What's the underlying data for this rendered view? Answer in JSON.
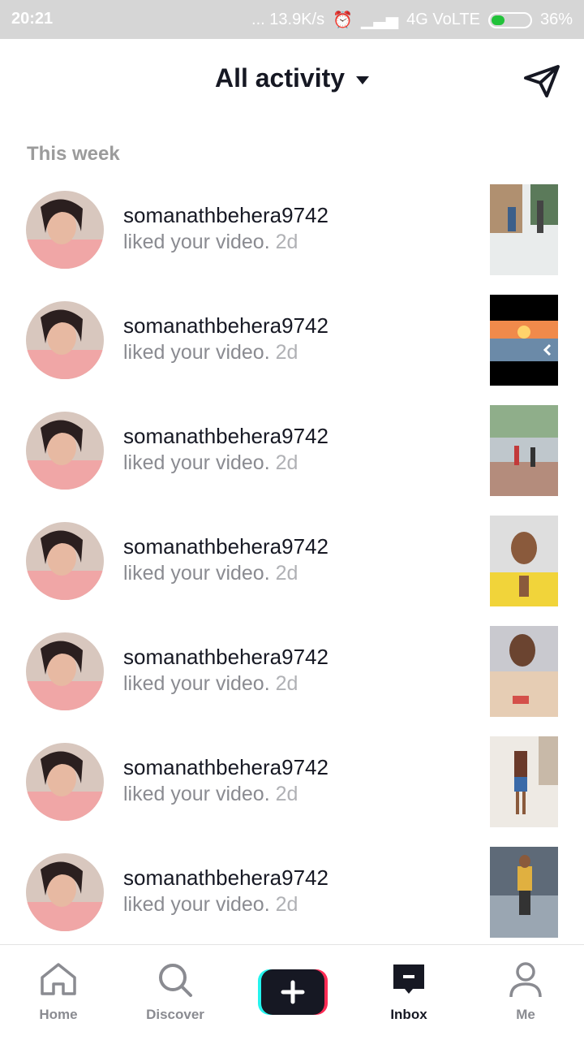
{
  "status": {
    "time": "20:21",
    "network_speed": "... 13.9K/s",
    "network_type": "4G VoLTE",
    "battery": "36%",
    "battery_level": 0.36
  },
  "header": {
    "title": "All activity",
    "dm_icon": "paper-plane-icon"
  },
  "section": {
    "label": "This week"
  },
  "notifications": [
    {
      "username": "somanathbehera9742",
      "action": "liked your video.",
      "ago": "2d"
    },
    {
      "username": "somanathbehera9742",
      "action": "liked your video.",
      "ago": "2d"
    },
    {
      "username": "somanathbehera9742",
      "action": "liked your video.",
      "ago": "2d"
    },
    {
      "username": "somanathbehera9742",
      "action": "liked your video.",
      "ago": "2d"
    },
    {
      "username": "somanathbehera9742",
      "action": "liked your video.",
      "ago": "2d"
    },
    {
      "username": "somanathbehera9742",
      "action": "liked your video.",
      "ago": "2d"
    },
    {
      "username": "somanathbehera9742",
      "action": "liked your video.",
      "ago": "2d"
    }
  ],
  "tabs": {
    "home": "Home",
    "discover": "Discover",
    "create_icon": "plus-icon",
    "inbox": "Inbox",
    "me": "Me"
  },
  "colors": {
    "text": "#161823",
    "muted": "#8a8b91",
    "accent_cyan": "#25f4ee",
    "accent_pink": "#fe2c55"
  }
}
